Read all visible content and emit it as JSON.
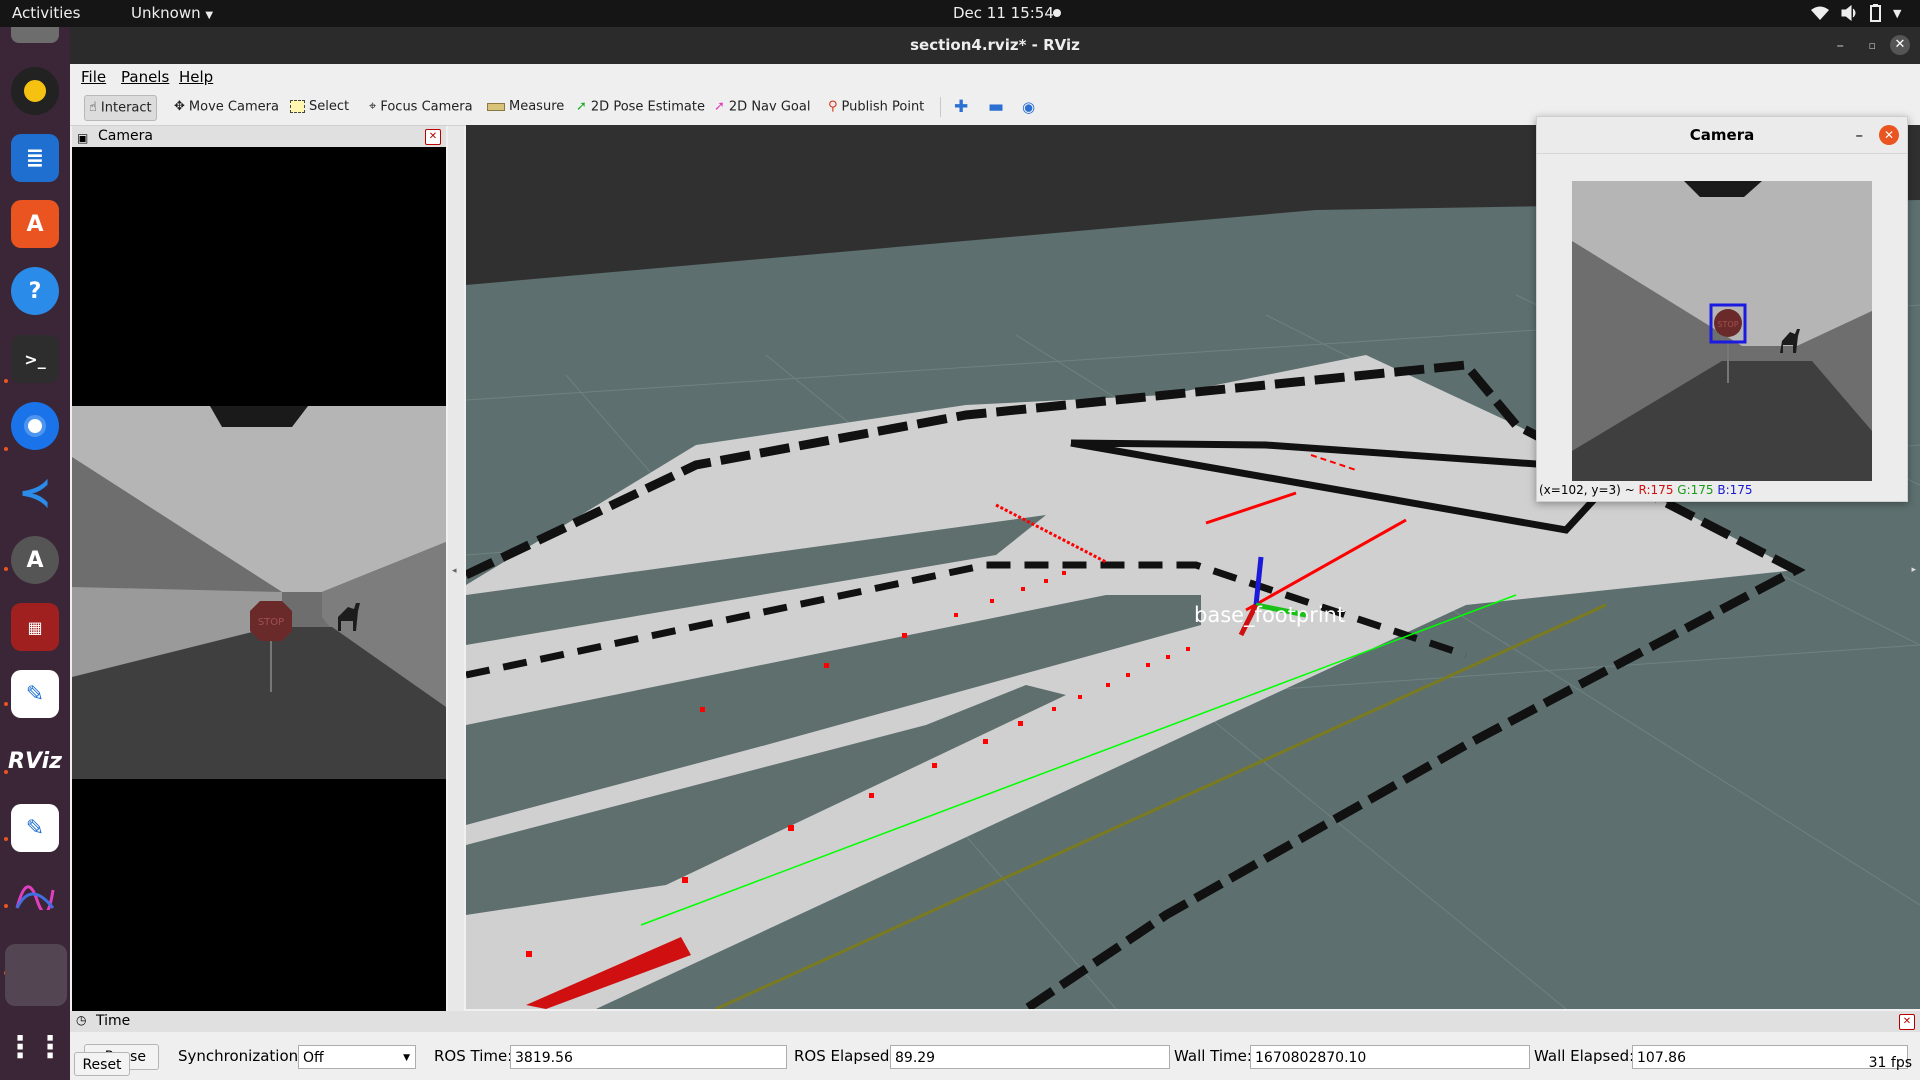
{
  "topbar": {
    "activities": "Activities",
    "app_menu": "Unknown",
    "datetime": "Dec 11  15:54"
  },
  "window": {
    "title": "section4.rviz* - RViz"
  },
  "menu": {
    "items": [
      "File",
      "Panels",
      "Help"
    ]
  },
  "toolbar": {
    "tools": [
      {
        "label": "Interact",
        "icon": "pointer-hand-icon"
      },
      {
        "label": "Move Camera",
        "icon": "move-arrows-icon"
      },
      {
        "label": "Select",
        "icon": "select-rect-icon"
      },
      {
        "label": "Focus Camera",
        "icon": "focus-crosshair-icon"
      },
      {
        "label": "Measure",
        "icon": "ruler-icon"
      },
      {
        "label": "2D Pose Estimate",
        "icon": "green-arrow-icon"
      },
      {
        "label": "2D Nav Goal",
        "icon": "pink-arrow-icon"
      },
      {
        "label": "Publish Point",
        "icon": "location-pin-icon"
      }
    ]
  },
  "camera_panel": {
    "title": "Camera"
  },
  "view3d": {
    "frame_label": "base_footprint"
  },
  "float_camera": {
    "title": "Camera",
    "pixel_info": "(x=102, y=3) ~ ",
    "r": "R:175",
    "g": "G:175",
    "b": "B:175"
  },
  "scene": {
    "stop_sign_text": "STOP"
  },
  "time_panel": {
    "title": "Time",
    "pause_label": "Pause",
    "sync_label": "Synchronization:",
    "sync_value": "Off",
    "ros_time_label": "ROS Time:",
    "ros_time": "3819.56",
    "ros_elapsed_label": "ROS Elapsed:",
    "ros_elapsed": "89.29",
    "wall_time_label": "Wall Time:",
    "wall_time": "1670802870.10",
    "wall_elapsed_label": "Wall Elapsed:",
    "wall_elapsed": "107.86",
    "reset_label": "Reset",
    "fps": "31 fps"
  },
  "colors": {
    "accent": "#e95420",
    "dock_bg": "#3a2637",
    "floor": "#5d706f",
    "map_free": "#d0d0d0",
    "laser": "#ff0000",
    "path": "#00ff00"
  }
}
